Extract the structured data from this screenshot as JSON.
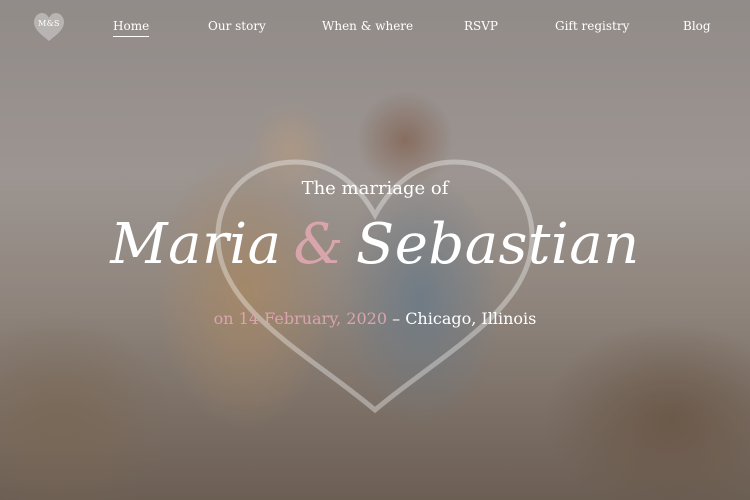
{
  "brand": {
    "monogram": "M&S"
  },
  "nav": {
    "items": [
      {
        "label": "Home",
        "active": true
      },
      {
        "label": "Our story"
      },
      {
        "label": "When & where"
      },
      {
        "label": "RSVP"
      },
      {
        "label": "Gift registry"
      },
      {
        "label": "Blog"
      }
    ]
  },
  "hero": {
    "intro": "The marriage of",
    "bride": "Maria",
    "ampersand": "&",
    "groom": "Sebastian",
    "date_text": "on 14 February, 2020",
    "separator": " – ",
    "location_text": "Chicago, Illinois"
  },
  "colors": {
    "accent_pink": "#d9a5ad",
    "text_white": "#ffffff"
  }
}
